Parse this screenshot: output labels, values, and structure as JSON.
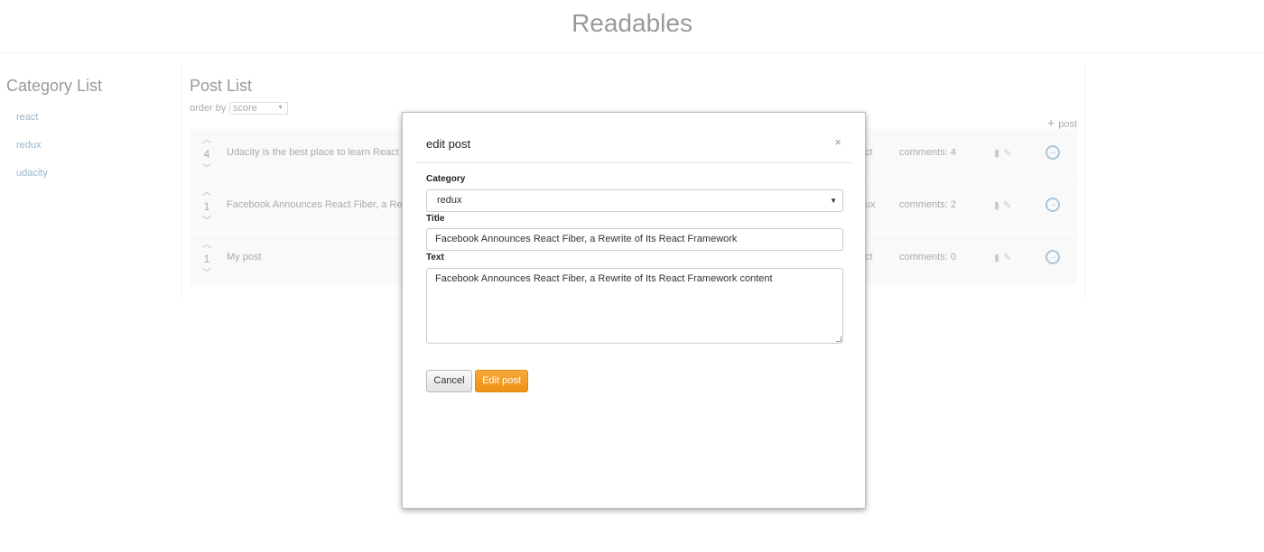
{
  "app": {
    "title": "Readables"
  },
  "sidebar": {
    "heading": "Category List",
    "items": [
      {
        "label": "react"
      },
      {
        "label": "redux"
      },
      {
        "label": "udacity"
      }
    ]
  },
  "posts": {
    "heading": "Post List",
    "order_label": "order by",
    "order_value": "score",
    "add_label": "post",
    "rows": [
      {
        "score": "4",
        "title": "Udacity is the best place to learn React",
        "category_tail": "ct",
        "comments": "comments: 4"
      },
      {
        "score": "1",
        "title": "Facebook Announces React Fiber, a Rewri",
        "category_tail": "ux",
        "comments": "comments: 2"
      },
      {
        "score": "1",
        "title": "My post",
        "category_tail": "ct",
        "comments": "comments: 0"
      }
    ]
  },
  "modal": {
    "title": "edit post",
    "close": "×",
    "category_label": "Category",
    "category_value": "redux",
    "title_label": "Title",
    "title_value": "Facebook Announces React Fiber, a Rewrite of Its React Framework",
    "text_label": "Text",
    "text_value": "Facebook Announces React Fiber, a Rewrite of Its React Framework content",
    "cancel_label": "Cancel",
    "submit_label": "Edit post"
  },
  "colors": {
    "accent": "#f29a21",
    "link": "#99b6c9"
  }
}
